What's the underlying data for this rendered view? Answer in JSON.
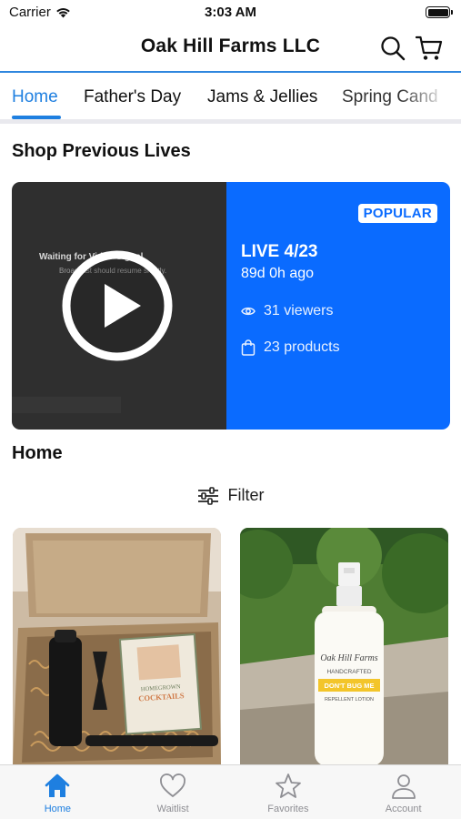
{
  "status_bar": {
    "carrier": "Carrier",
    "time": "3:03 AM"
  },
  "nav": {
    "title": "Oak Hill Farms LLC"
  },
  "tabs": [
    {
      "label": "Home",
      "active": true
    },
    {
      "label": "Father's Day"
    },
    {
      "label": "Jams & Jellies"
    },
    {
      "label": "Spring Cand"
    }
  ],
  "shop_previous_lives": {
    "title": "Shop Previous Lives",
    "card": {
      "video_overlay_text": "Waiting for Video Signal",
      "video_overlay_subtext": "Broadcast should resume shortly.",
      "badge": "POPULAR",
      "live_label": "LIVE 4/23",
      "ago": "89d 0h ago",
      "viewers": "31 viewers",
      "products": "23 products"
    }
  },
  "home_section": {
    "title": "Home",
    "filter_label": "Filter"
  },
  "products": [
    {
      "name": "product-cocktail-kit",
      "book_title": "HOMEGROWN COCKTAILS"
    },
    {
      "name": "product-bug-lotion",
      "label_brand": "Oak Hill Farms",
      "label_line1": "HANDCRAFTED",
      "label_line2": "DON'T BUG ME",
      "label_line3": "REPELLENT LOTION"
    }
  ],
  "tabbar": [
    {
      "label": "Home",
      "icon": "home-icon",
      "active": true
    },
    {
      "label": "Waitlist",
      "icon": "heart-icon"
    },
    {
      "label": "Favorites",
      "icon": "star-icon"
    },
    {
      "label": "Account",
      "icon": "person-icon"
    }
  ],
  "colors": {
    "accent": "#1e7fe0",
    "live_card": "#0a6bff",
    "video_bg": "#2f2f2f"
  }
}
